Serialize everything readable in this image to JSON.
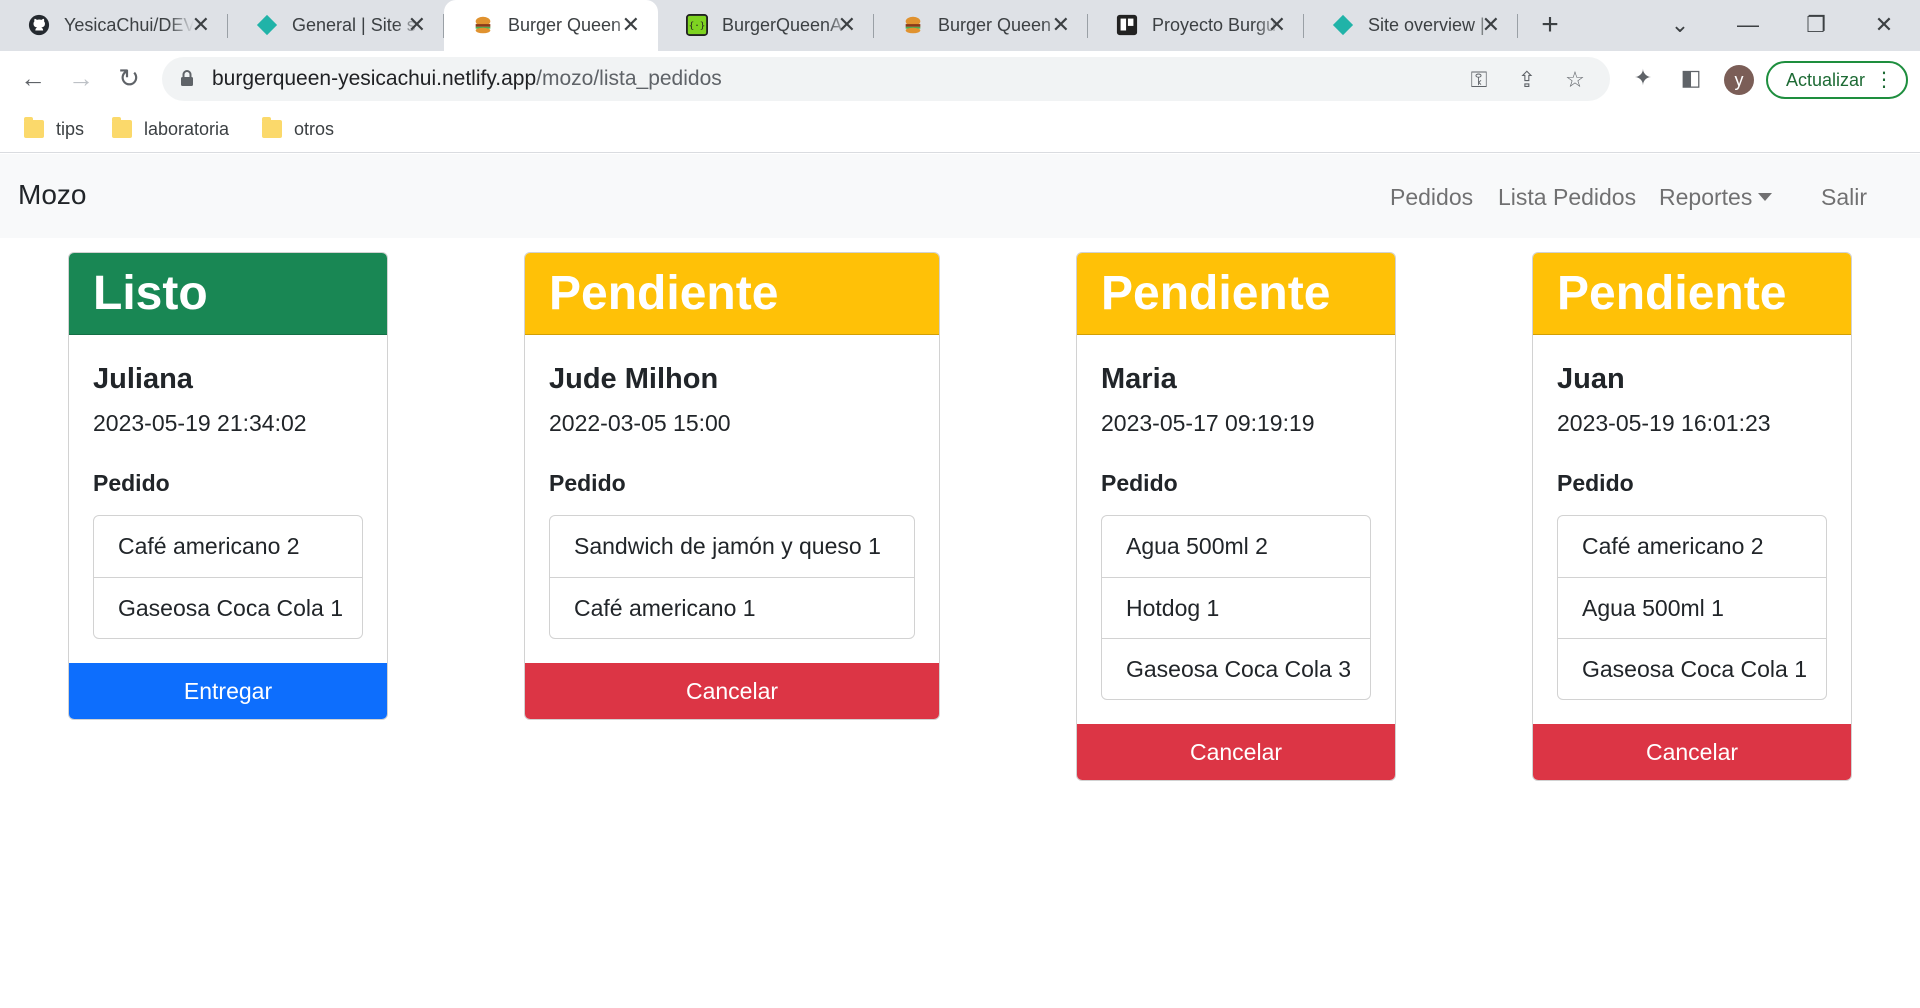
{
  "browser": {
    "tabs": [
      {
        "title": "YesicaChui/DEV",
        "icon": "github-icon"
      },
      {
        "title": "General | Site s",
        "icon": "netlify-icon"
      },
      {
        "title": "Burger Queen",
        "icon": "burger-icon",
        "active": true
      },
      {
        "title": "BurgerQueenA",
        "icon": "json-icon"
      },
      {
        "title": "Burger Queen",
        "icon": "burger-icon"
      },
      {
        "title": "Proyecto Burgu",
        "icon": "trello-icon"
      },
      {
        "title": "Site overview |",
        "icon": "netlify-icon"
      }
    ],
    "url_host": "burgerqueen-yesicachui.netlify.app",
    "url_path": "/mozo/lista_pedidos",
    "profile_initial": "y",
    "update_label": "Actualizar",
    "bookmarks": [
      "tips",
      "laboratoria",
      "otros"
    ]
  },
  "navbar": {
    "brand": "Mozo",
    "links": [
      "Pedidos",
      "Lista Pedidos",
      "Reportes",
      "Salir"
    ]
  },
  "orders": [
    {
      "status": "Listo",
      "customer": "Juliana",
      "datetime": "2023-05-19 21:34:02",
      "pedido_label": "Pedido",
      "items": [
        "Café americano 2",
        "Gaseosa Coca Cola 1"
      ],
      "action": "Entregar"
    },
    {
      "status": "Pendiente",
      "customer": "Jude Milhon",
      "datetime": "2022-03-05 15:00",
      "pedido_label": "Pedido",
      "items": [
        "Sandwich de jamón y queso 1",
        "Café americano 1"
      ],
      "action": "Cancelar"
    },
    {
      "status": "Pendiente",
      "customer": "Maria",
      "datetime": "2023-05-17 09:19:19",
      "pedido_label": "Pedido",
      "items": [
        "Agua 500ml 2",
        "Hotdog 1",
        "Gaseosa Coca Cola 3"
      ],
      "action": "Cancelar"
    },
    {
      "status": "Pendiente",
      "customer": "Juan",
      "datetime": "2023-05-19 16:01:23",
      "pedido_label": "Pedido",
      "items": [
        "Café americano 2",
        "Agua 500ml 1",
        "Gaseosa Coca Cola 1"
      ],
      "action": "Cancelar"
    }
  ],
  "colors": {
    "listo": "#198754",
    "pendiente": "#ffc107",
    "primary": "#0d6efd",
    "danger": "#dc3545"
  }
}
